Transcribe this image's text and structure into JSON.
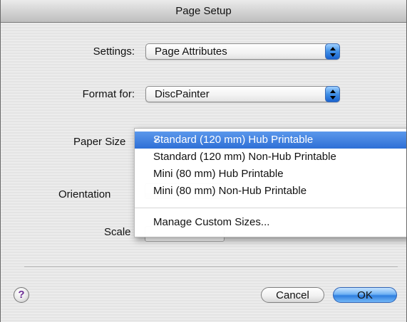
{
  "window": {
    "title": "Page Setup"
  },
  "settings": {
    "label": "Settings:",
    "value": "Page Attributes"
  },
  "format_for": {
    "label": "Format for:",
    "value": "DiscPainter"
  },
  "paper_size": {
    "label": "Paper Size",
    "menu_items": [
      {
        "label": "Standard (120 mm) Hub Printable",
        "selected": true
      },
      {
        "label": "Standard (120 mm) Non-Hub Printable",
        "selected": false
      },
      {
        "label": "Mini (80 mm) Hub Printable",
        "selected": false
      },
      {
        "label": "Mini (80 mm) Non-Hub Printable",
        "selected": false
      }
    ],
    "manage_label": "Manage Custom Sizes...",
    "check_glyph": "✓"
  },
  "orientation": {
    "label": "Orientation"
  },
  "scale": {
    "label": "Scale"
  },
  "footer": {
    "help_glyph": "?",
    "cancel_label": "Cancel",
    "ok_label": "OK"
  },
  "colors": {
    "selection": "#3a7de0",
    "default_button": "#4a9bf0"
  }
}
